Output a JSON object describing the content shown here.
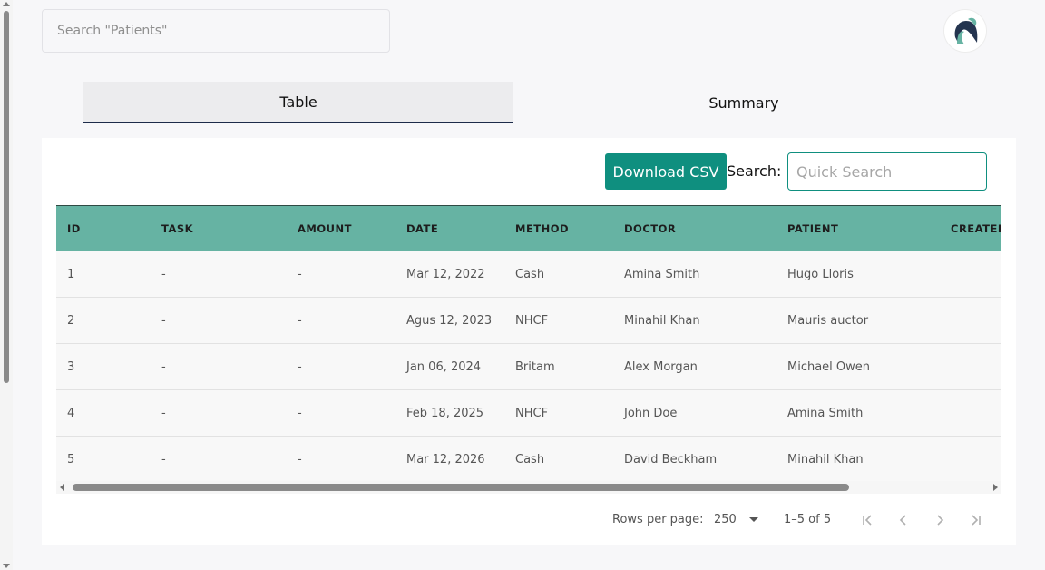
{
  "search": {
    "placeholder": "Search \"Patients\""
  },
  "tabs": [
    {
      "label": "Table",
      "active": true
    },
    {
      "label": "Summary",
      "active": false
    }
  ],
  "toolbar": {
    "download_label": "Download CSV",
    "search_label": "Search:",
    "quick_search_placeholder": "Quick Search"
  },
  "table": {
    "columns": [
      "ID",
      "TASK",
      "AMOUNT",
      "DATE",
      "METHOD",
      "DOCTOR",
      "PATIENT",
      "CREATED"
    ],
    "rows": [
      [
        "1",
        "-",
        "-",
        "Mar 12, 2022",
        "Cash",
        "Amina Smith",
        "Hugo Lloris",
        ""
      ],
      [
        "2",
        "-",
        "-",
        "Agus 12, 2023",
        "NHCF",
        "Minahil Khan",
        "Mauris auctor",
        ""
      ],
      [
        "3",
        "-",
        "-",
        "Jan 06, 2024",
        "Britam",
        "Alex Morgan",
        "Michael Owen",
        ""
      ],
      [
        "4",
        "-",
        "-",
        "Feb 18, 2025",
        "NHCF",
        "John Doe",
        "Amina Smith",
        ""
      ],
      [
        "5",
        "-",
        "-",
        "Mar 12, 2026",
        "Cash",
        "David Beckham",
        "Minahil Khan",
        ""
      ]
    ]
  },
  "pagination": {
    "rows_label": "Rows per page:",
    "rows_value": "250",
    "range": "1–5 of 5"
  },
  "colors": {
    "accent": "#0f8f7f",
    "header_bg": "#66b3a3",
    "tab_indicator": "#1d2b4a"
  }
}
